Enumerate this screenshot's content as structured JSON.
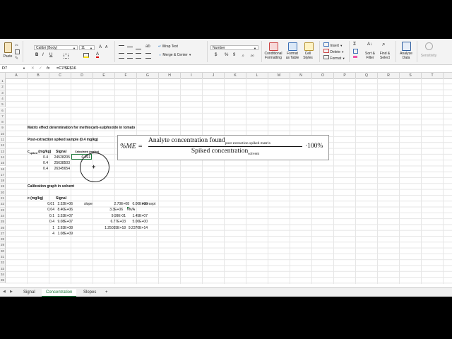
{
  "ribbon": {
    "paste": "Paste",
    "font_name": "Calibri (Body)",
    "font_size": "11",
    "bold": "B",
    "italic": "I",
    "underline": "U",
    "wrap_text": "Wrap Text",
    "merge_center": "Merge & Center",
    "number_format": "Number",
    "currency": "$",
    "percent": "%",
    "comma": "9",
    "conditional_formatting": "Conditional Formatting",
    "format_as_table": "Format as Table",
    "cell_styles": "Cell Styles",
    "insert": "Insert",
    "delete": "Delete",
    "format": "Format",
    "sort_filter": "Sort & Filter",
    "find_select": "Find & Select",
    "analyze_data": "Analyze Data",
    "sensitivity": "Sensitivity"
  },
  "formula_bar": {
    "name_box": "D7",
    "fx": "fx",
    "formula": "=C7/$E$16"
  },
  "columns": [
    "A",
    "B",
    "C",
    "D",
    "E",
    "F",
    "G",
    "H",
    "I",
    "J",
    "K",
    "L",
    "M",
    "N",
    "O",
    "P",
    "Q",
    "R",
    "S",
    "T"
  ],
  "rows": [
    "1",
    "2",
    "3",
    "4",
    "5",
    "6",
    "7",
    "8",
    "9",
    "10",
    "11",
    "12",
    "13",
    "14",
    "15",
    "16",
    "17",
    "18",
    "19",
    "20",
    "21",
    "22",
    "23",
    "24",
    "25",
    "26",
    "27",
    "28",
    "29",
    "30",
    "31",
    "32",
    "33",
    "34",
    "35"
  ],
  "sheet": {
    "title": "Matrix effect determination for methiocarb-sulphoxide in tomato",
    "post_extraction": "Post-extraction spiked sample (0.4 mg/kg)",
    "c_spiked": "c",
    "c_spiked_sub": "spiked",
    "c_spiked_unit": " (mg/kg)",
    "signal_header": "Signal",
    "calculated_header": "Calculated (mg/kg)",
    "post_rows": [
      {
        "c": "0.4",
        "signal": "24528205",
        "calc": "0.091"
      },
      {
        "c": "0.4",
        "signal": "25638503",
        "calc": ""
      },
      {
        "c": "0.4",
        "signal": "26345654",
        "calc": ""
      }
    ],
    "calibration_title": "Calibration graph in solvent",
    "c_header": "c (mg/kg)",
    "signal_header2": "Signal",
    "cal_rows": [
      {
        "c": "0.01",
        "signal": "2.52E+06"
      },
      {
        "c": "0.04",
        "signal": "8.40E+06"
      },
      {
        "c": "0.1",
        "signal": "3.53E+07"
      },
      {
        "c": "0.4",
        "signal": "9.08E+07"
      },
      {
        "c": "1",
        "signal": "2.93E+08"
      },
      {
        "c": "4",
        "signal": "1.08E+09"
      }
    ],
    "slope_label": "slope",
    "intercept_label": "intercept",
    "linest": [
      [
        "2.70E+08",
        "0.00E+00"
      ],
      [
        "3.3E+06",
        "#N/A"
      ],
      [
        "9.99E-01",
        "1.45E+07"
      ],
      [
        "6.77E+03",
        "5.00E+00"
      ],
      [
        "1.25035E+18",
        "9.2370E+14"
      ]
    ]
  },
  "equation": {
    "lhs": "%ME =",
    "numerator": "Analyte concentration found",
    "numerator_sub": "post-extraction spiked matrix",
    "denominator": "Spiked concentration",
    "denominator_sub": "solvent",
    "suffix": "·100%"
  },
  "tabs": [
    "Signal",
    "Concentration",
    "Slopes"
  ],
  "active_tab": "Concentration",
  "add_tab": "+"
}
